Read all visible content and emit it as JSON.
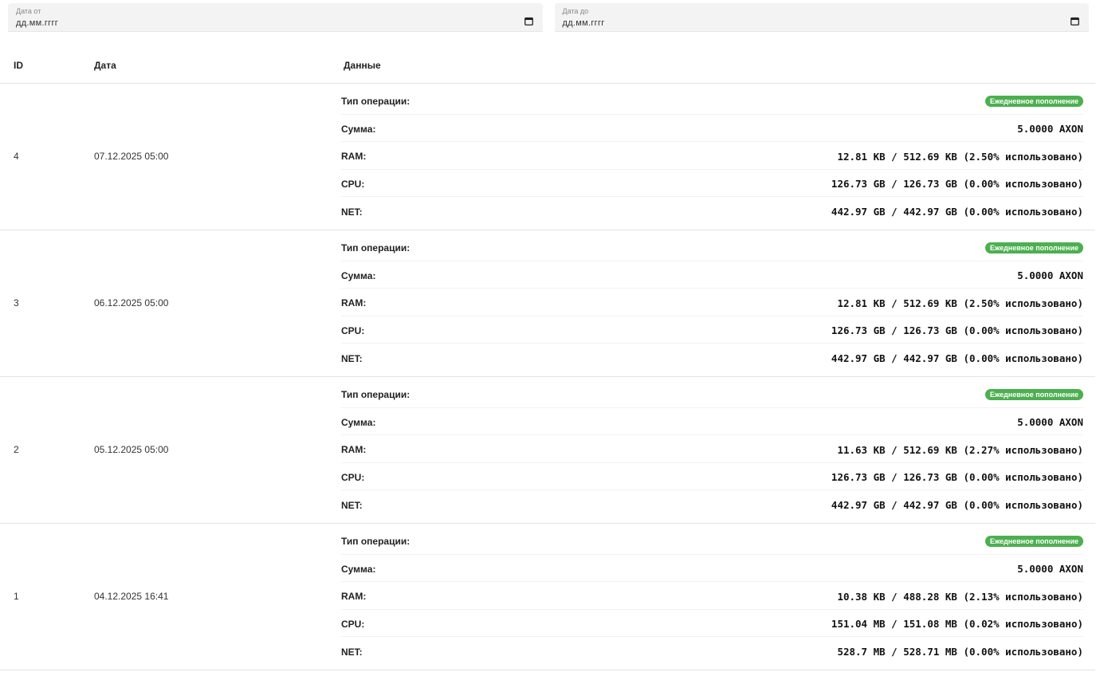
{
  "filters": {
    "from": {
      "label": "Дата от",
      "placeholder": "дд.мм.гггг"
    },
    "to": {
      "label": "Дата до",
      "placeholder": "дд.мм.гггг"
    }
  },
  "table": {
    "headers": {
      "id": "ID",
      "date": "Дата",
      "data": "Данные"
    },
    "field_labels": {
      "type": "Тип операции:",
      "amount": "Сумма:",
      "ram": "RAM:",
      "cpu": "CPU:",
      "net": "NET:"
    },
    "rows": [
      {
        "id": "4",
        "date": "07.12.2025 05:00",
        "type": "Ежедневное пополнение",
        "amount": "5.0000 AXON",
        "ram": "12.81 KB / 512.69 KB (2.50% использовано)",
        "cpu": "126.73 GB / 126.73 GB (0.00% использовано)",
        "net": "442.97 GB / 442.97 GB (0.00% использовано)"
      },
      {
        "id": "3",
        "date": "06.12.2025 05:00",
        "type": "Ежедневное пополнение",
        "amount": "5.0000 AXON",
        "ram": "12.81 KB / 512.69 KB (2.50% использовано)",
        "cpu": "126.73 GB / 126.73 GB (0.00% использовано)",
        "net": "442.97 GB / 442.97 GB (0.00% использовано)"
      },
      {
        "id": "2",
        "date": "05.12.2025 05:00",
        "type": "Ежедневное пополнение",
        "amount": "5.0000 AXON",
        "ram": "11.63 KB / 512.69 KB (2.27% использовано)",
        "cpu": "126.73 GB / 126.73 GB (0.00% использовано)",
        "net": "442.97 GB / 442.97 GB (0.00% использовано)"
      },
      {
        "id": "1",
        "date": "04.12.2025 16:41",
        "type": "Ежедневное пополнение",
        "amount": "5.0000 AXON",
        "ram": "10.38 KB / 488.28 KB (2.13% использовано)",
        "cpu": "151.04 MB / 151.08 MB (0.02% использовано)",
        "net": "528.7 MB / 528.71 MB (0.00% использовано)"
      }
    ]
  },
  "colors": {
    "badge": "#4caf50"
  },
  "icons": {
    "calendar": "calendar-icon"
  }
}
